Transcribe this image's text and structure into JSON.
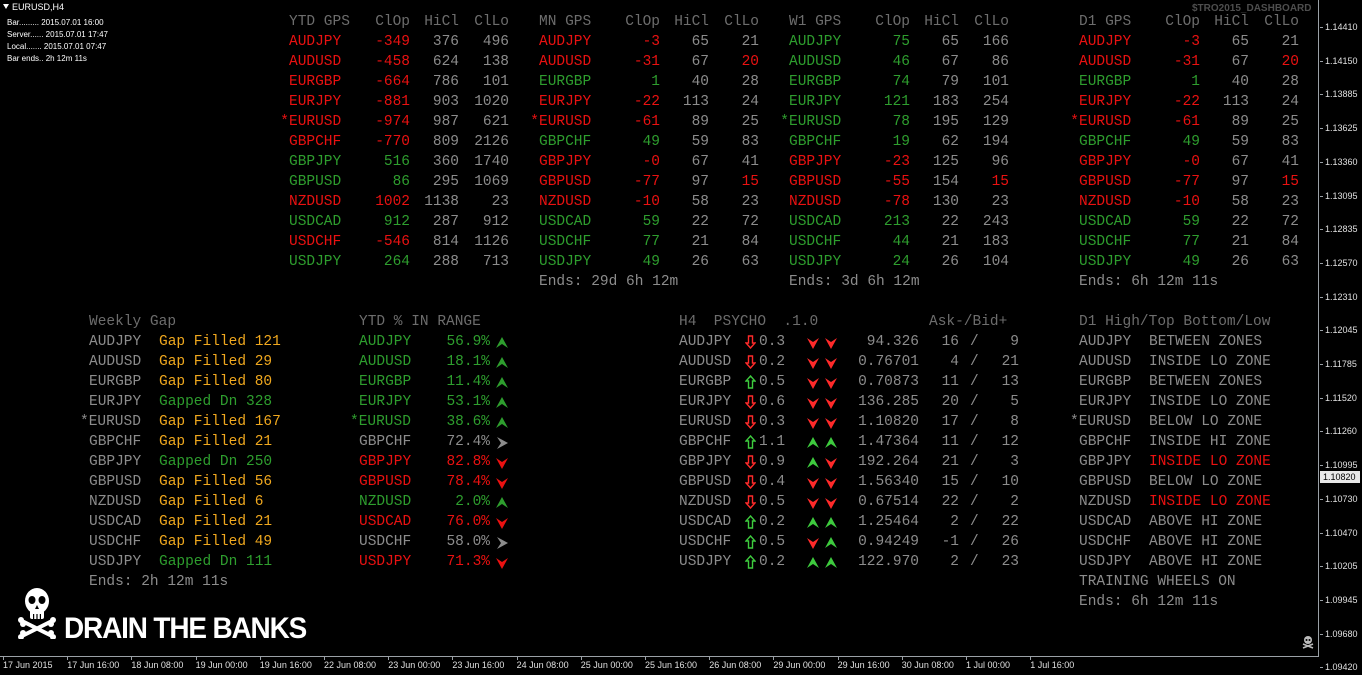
{
  "chart": {
    "symbol_tf": "EURUSD,H4",
    "info_lines": [
      "Bar......... 2015.07.01 16:00",
      "Server...... 2015.07.01 17:47",
      "Local....... 2015.07.01 07:47",
      "Bar ends.. 2h 12m 11s"
    ],
    "dashboard_name": "$TRO2015_DASHBOARD",
    "price_labels": [
      "1.14410",
      "1.14150",
      "1.13885",
      "1.13625",
      "1.13360",
      "1.13095",
      "1.12835",
      "1.12570",
      "1.12310",
      "1.12045",
      "1.11785",
      "1.11520",
      "1.11260",
      "1.10995",
      "1.10730",
      "1.10470",
      "1.10205",
      "1.09945",
      "1.09680",
      "1.09420"
    ],
    "current_price": "1.10820",
    "time_labels": [
      "17 Jun 2015",
      "17 Jun 16:00",
      "18 Jun 08:00",
      "19 Jun 00:00",
      "19 Jun 16:00",
      "22 Jun 08:00",
      "23 Jun 00:00",
      "23 Jun 16:00",
      "24 Jun 08:00",
      "25 Jun 00:00",
      "25 Jun 16:00",
      "26 Jun 08:00",
      "29 Jun 00:00",
      "29 Jun 16:00",
      "30 Jun 08:00",
      "1 Jul 00:00",
      "1 Jul 16:00"
    ],
    "logo_text": "DRAIN THE BANKS",
    "logo_icon": "skull-crossbones-icon"
  },
  "gps_columns": [
    "ClOp",
    "HiCl",
    "ClLo"
  ],
  "gps_tables": [
    {
      "title": "YTD GPS",
      "ends": "",
      "rows": [
        {
          "pair": "AUDJPY",
          "c": "r",
          "v": [
            "-349",
            "376",
            "496"
          ],
          "hl": [
            0,
            0,
            0
          ]
        },
        {
          "pair": "AUDUSD",
          "c": "r",
          "v": [
            "-458",
            "624",
            "138"
          ],
          "hl": [
            0,
            0,
            0
          ]
        },
        {
          "pair": "EURGBP",
          "c": "r",
          "v": [
            "-664",
            "786",
            "101"
          ],
          "hl": [
            0,
            0,
            0
          ]
        },
        {
          "pair": "EURJPY",
          "c": "r",
          "v": [
            "-881",
            "903",
            "1020"
          ],
          "hl": [
            0,
            0,
            0
          ]
        },
        {
          "pair": "*EURUSD",
          "c": "r",
          "v": [
            "-974",
            "987",
            "621"
          ],
          "hl": [
            0,
            0,
            0
          ]
        },
        {
          "pair": "GBPCHF",
          "c": "r",
          "v": [
            "-770",
            "809",
            "2126"
          ],
          "hl": [
            0,
            0,
            0
          ]
        },
        {
          "pair": "GBPJPY",
          "c": "g",
          "v": [
            "516",
            "360",
            "1740"
          ],
          "hl": [
            0,
            0,
            0
          ]
        },
        {
          "pair": "GBPUSD",
          "c": "g",
          "v": [
            "86",
            "295",
            "1069"
          ],
          "hl": [
            0,
            0,
            0
          ]
        },
        {
          "pair": "NZDUSD",
          "c": "r",
          "v": [
            "1002",
            "1138",
            "23"
          ],
          "hl": [
            0,
            0,
            0
          ]
        },
        {
          "pair": "USDCAD",
          "c": "g",
          "v": [
            "912",
            "287",
            "912"
          ],
          "hl": [
            0,
            0,
            0
          ]
        },
        {
          "pair": "USDCHF",
          "c": "r",
          "v": [
            "-546",
            "814",
            "1126"
          ],
          "hl": [
            0,
            0,
            0
          ]
        },
        {
          "pair": "USDJPY",
          "c": "g",
          "v": [
            "264",
            "288",
            "713"
          ],
          "hl": [
            0,
            0,
            0
          ]
        }
      ]
    },
    {
      "title": "MN GPS",
      "ends": "Ends: 29d 6h 12m",
      "rows": [
        {
          "pair": "AUDJPY",
          "c": "r",
          "v": [
            "-3",
            "65",
            "21"
          ],
          "hl": [
            0,
            0,
            0
          ]
        },
        {
          "pair": "AUDUSD",
          "c": "r",
          "v": [
            "-31",
            "67",
            "20"
          ],
          "hl": [
            0,
            0,
            1
          ]
        },
        {
          "pair": "EURGBP",
          "c": "g",
          "v": [
            "1",
            "40",
            "28"
          ],
          "hl": [
            0,
            0,
            0
          ]
        },
        {
          "pair": "EURJPY",
          "c": "r",
          "v": [
            "-22",
            "113",
            "24"
          ],
          "hl": [
            0,
            0,
            0
          ]
        },
        {
          "pair": "*EURUSD",
          "c": "r",
          "v": [
            "-61",
            "89",
            "25"
          ],
          "hl": [
            0,
            0,
            0
          ]
        },
        {
          "pair": "GBPCHF",
          "c": "g",
          "v": [
            "49",
            "59",
            "83"
          ],
          "hl": [
            0,
            0,
            0
          ]
        },
        {
          "pair": "GBPJPY",
          "c": "r",
          "v": [
            "-0",
            "67",
            "41"
          ],
          "hl": [
            0,
            0,
            0
          ]
        },
        {
          "pair": "GBPUSD",
          "c": "r",
          "v": [
            "-77",
            "97",
            "15"
          ],
          "hl": [
            0,
            0,
            1
          ]
        },
        {
          "pair": "NZDUSD",
          "c": "r",
          "v": [
            "-10",
            "58",
            "23"
          ],
          "hl": [
            0,
            0,
            0
          ]
        },
        {
          "pair": "USDCAD",
          "c": "g",
          "v": [
            "59",
            "22",
            "72"
          ],
          "hl": [
            0,
            0,
            0
          ]
        },
        {
          "pair": "USDCHF",
          "c": "g",
          "v": [
            "77",
            "21",
            "84"
          ],
          "hl": [
            0,
            0,
            0
          ]
        },
        {
          "pair": "USDJPY",
          "c": "g",
          "v": [
            "49",
            "26",
            "63"
          ],
          "hl": [
            0,
            0,
            0
          ]
        }
      ]
    },
    {
      "title": "W1 GPS",
      "ends": "Ends: 3d 6h 12m",
      "rows": [
        {
          "pair": "AUDJPY",
          "c": "g",
          "v": [
            "75",
            "65",
            "166"
          ],
          "hl": [
            0,
            0,
            0
          ]
        },
        {
          "pair": "AUDUSD",
          "c": "g",
          "v": [
            "46",
            "67",
            "86"
          ],
          "hl": [
            0,
            0,
            0
          ]
        },
        {
          "pair": "EURGBP",
          "c": "g",
          "v": [
            "74",
            "79",
            "101"
          ],
          "hl": [
            0,
            0,
            0
          ]
        },
        {
          "pair": "EURJPY",
          "c": "g",
          "v": [
            "121",
            "183",
            "254"
          ],
          "hl": [
            0,
            0,
            0
          ]
        },
        {
          "pair": "*EURUSD",
          "c": "g",
          "v": [
            "78",
            "195",
            "129"
          ],
          "hl": [
            0,
            0,
            0
          ]
        },
        {
          "pair": "GBPCHF",
          "c": "g",
          "v": [
            "19",
            "62",
            "194"
          ],
          "hl": [
            0,
            0,
            0
          ]
        },
        {
          "pair": "GBPJPY",
          "c": "r",
          "v": [
            "-23",
            "125",
            "96"
          ],
          "hl": [
            0,
            0,
            0
          ]
        },
        {
          "pair": "GBPUSD",
          "c": "r",
          "v": [
            "-55",
            "154",
            "15"
          ],
          "hl": [
            0,
            0,
            1
          ]
        },
        {
          "pair": "NZDUSD",
          "c": "r",
          "v": [
            "-78",
            "130",
            "23"
          ],
          "hl": [
            0,
            0,
            0
          ]
        },
        {
          "pair": "USDCAD",
          "c": "g",
          "v": [
            "213",
            "22",
            "243"
          ],
          "hl": [
            0,
            0,
            0
          ]
        },
        {
          "pair": "USDCHF",
          "c": "g",
          "v": [
            "44",
            "21",
            "183"
          ],
          "hl": [
            0,
            0,
            0
          ]
        },
        {
          "pair": "USDJPY",
          "c": "g",
          "v": [
            "24",
            "26",
            "104"
          ],
          "hl": [
            0,
            0,
            0
          ]
        }
      ]
    },
    {
      "title": "D1 GPS",
      "ends": "Ends: 6h 12m 11s",
      "rows": [
        {
          "pair": "AUDJPY",
          "c": "r",
          "v": [
            "-3",
            "65",
            "21"
          ],
          "hl": [
            0,
            0,
            0
          ]
        },
        {
          "pair": "AUDUSD",
          "c": "r",
          "v": [
            "-31",
            "67",
            "20"
          ],
          "hl": [
            0,
            0,
            1
          ]
        },
        {
          "pair": "EURGBP",
          "c": "g",
          "v": [
            "1",
            "40",
            "28"
          ],
          "hl": [
            0,
            0,
            0
          ]
        },
        {
          "pair": "EURJPY",
          "c": "r",
          "v": [
            "-22",
            "113",
            "24"
          ],
          "hl": [
            0,
            0,
            0
          ]
        },
        {
          "pair": "*EURUSD",
          "c": "r",
          "v": [
            "-61",
            "89",
            "25"
          ],
          "hl": [
            0,
            0,
            0
          ]
        },
        {
          "pair": "GBPCHF",
          "c": "g",
          "v": [
            "49",
            "59",
            "83"
          ],
          "hl": [
            0,
            0,
            0
          ]
        },
        {
          "pair": "GBPJPY",
          "c": "r",
          "v": [
            "-0",
            "67",
            "41"
          ],
          "hl": [
            0,
            0,
            0
          ]
        },
        {
          "pair": "GBPUSD",
          "c": "r",
          "v": [
            "-77",
            "97",
            "15"
          ],
          "hl": [
            0,
            0,
            1
          ]
        },
        {
          "pair": "NZDUSD",
          "c": "r",
          "v": [
            "-10",
            "58",
            "23"
          ],
          "hl": [
            0,
            0,
            0
          ]
        },
        {
          "pair": "USDCAD",
          "c": "g",
          "v": [
            "59",
            "22",
            "72"
          ],
          "hl": [
            0,
            0,
            0
          ]
        },
        {
          "pair": "USDCHF",
          "c": "g",
          "v": [
            "77",
            "21",
            "84"
          ],
          "hl": [
            0,
            0,
            0
          ]
        },
        {
          "pair": "USDJPY",
          "c": "g",
          "v": [
            "49",
            "26",
            "63"
          ],
          "hl": [
            0,
            0,
            0
          ]
        }
      ]
    }
  ],
  "weekly_gap": {
    "title": "Weekly Gap",
    "ends": "Ends: 2h 12m 11s",
    "rows": [
      {
        "pair": "AUDJPY",
        "status": "Gap Filled 121",
        "c": "o"
      },
      {
        "pair": "AUDUSD",
        "status": "Gap Filled 29",
        "c": "o"
      },
      {
        "pair": "EURGBP",
        "status": "Gap Filled 80",
        "c": "o"
      },
      {
        "pair": "EURJPY",
        "status": "Gapped Dn 328",
        "c": "g"
      },
      {
        "pair": "*EURUSD",
        "status": "Gap Filled 167",
        "c": "o"
      },
      {
        "pair": "GBPCHF",
        "status": "Gap Filled 21",
        "c": "o"
      },
      {
        "pair": "GBPJPY",
        "status": "Gapped Dn 250",
        "c": "g"
      },
      {
        "pair": "GBPUSD",
        "status": "Gap Filled 56",
        "c": "o"
      },
      {
        "pair": "NZDUSD",
        "status": "Gap Filled 6",
        "c": "o"
      },
      {
        "pair": "USDCAD",
        "status": "Gap Filled 21",
        "c": "o"
      },
      {
        "pair": "USDCHF",
        "status": "Gap Filled 49",
        "c": "o"
      },
      {
        "pair": "USDJPY",
        "status": "Gapped Dn 111",
        "c": "g"
      }
    ]
  },
  "ytd_range": {
    "title": "YTD % IN RANGE",
    "rows": [
      {
        "pair": "AUDJPY",
        "pct": "56.9%",
        "c": "g",
        "arrow": "up"
      },
      {
        "pair": "AUDUSD",
        "pct": "18.1%",
        "c": "g",
        "arrow": "up"
      },
      {
        "pair": "EURGBP",
        "pct": "11.4%",
        "c": "g",
        "arrow": "up"
      },
      {
        "pair": "EURJPY",
        "pct": "53.1%",
        "c": "g",
        "arrow": "up"
      },
      {
        "pair": "*EURUSD",
        "pct": "38.6%",
        "c": "g",
        "arrow": "up"
      },
      {
        "pair": "GBPCHF",
        "pct": "72.4%",
        "c": "gr",
        "arrow": "right"
      },
      {
        "pair": "GBPJPY",
        "pct": "82.8%",
        "c": "r",
        "arrow": "down"
      },
      {
        "pair": "GBPUSD",
        "pct": "78.4%",
        "c": "r",
        "arrow": "down"
      },
      {
        "pair": "NZDUSD",
        "pct": "2.0%",
        "c": "g",
        "arrow": "up"
      },
      {
        "pair": "USDCAD",
        "pct": "76.0%",
        "c": "r",
        "arrow": "down"
      },
      {
        "pair": "USDCHF",
        "pct": "58.0%",
        "c": "gr",
        "arrow": "right"
      },
      {
        "pair": "USDJPY",
        "pct": "71.3%",
        "c": "r",
        "arrow": "down"
      }
    ]
  },
  "psycho": {
    "title": "H4  PSYCHO  .1.0",
    "askbid": "Ask-/Bid+",
    "rows": [
      {
        "pair": "AUDJPY",
        "dir": "down",
        "val": "0.3",
        "a1": "down",
        "a2": "down",
        "price": "94.326",
        "ask": "16",
        "bid": "9"
      },
      {
        "pair": "AUDUSD",
        "dir": "down",
        "val": "0.2",
        "a1": "down",
        "a2": "down",
        "price": "0.76701",
        "ask": "4",
        "bid": "21"
      },
      {
        "pair": "EURGBP",
        "dir": "up",
        "val": "0.5",
        "a1": "down",
        "a2": "down",
        "price": "0.70873",
        "ask": "11",
        "bid": "13"
      },
      {
        "pair": "EURJPY",
        "dir": "down",
        "val": "0.6",
        "a1": "down",
        "a2": "down",
        "price": "136.285",
        "ask": "20",
        "bid": "5"
      },
      {
        "pair": "EURUSD",
        "dir": "down",
        "val": "0.3",
        "a1": "down",
        "a2": "down",
        "price": "1.10820",
        "ask": "17",
        "bid": "8"
      },
      {
        "pair": "GBPCHF",
        "dir": "up",
        "val": "1.1",
        "a1": "up",
        "a2": "up",
        "price": "1.47364",
        "ask": "11",
        "bid": "12"
      },
      {
        "pair": "GBPJPY",
        "dir": "down",
        "val": "0.9",
        "a1": "up",
        "a2": "down",
        "price": "192.264",
        "ask": "21",
        "bid": "3"
      },
      {
        "pair": "GBPUSD",
        "dir": "down",
        "val": "0.4",
        "a1": "down",
        "a2": "down",
        "price": "1.56340",
        "ask": "15",
        "bid": "10"
      },
      {
        "pair": "NZDUSD",
        "dir": "down",
        "val": "0.5",
        "a1": "down",
        "a2": "down",
        "price": "0.67514",
        "ask": "22",
        "bid": "2"
      },
      {
        "pair": "USDCAD",
        "dir": "up",
        "val": "0.2",
        "a1": "up",
        "a2": "up",
        "price": "1.25464",
        "ask": "2",
        "bid": "22"
      },
      {
        "pair": "USDCHF",
        "dir": "up",
        "val": "0.5",
        "a1": "down",
        "a2": "up",
        "price": "0.94249",
        "ask": "-1",
        "bid": "26"
      },
      {
        "pair": "USDJPY",
        "dir": "up",
        "val": "0.2",
        "a1": "up",
        "a2": "up",
        "price": "122.970",
        "ask": "2",
        "bid": "23"
      }
    ]
  },
  "zones": {
    "title": "D1 High/Top Bottom/Low",
    "footer": "TRAINING WHEELS ON",
    "ends": "Ends: 6h 12m 11s",
    "rows": [
      {
        "pair": "AUDJPY",
        "zone": "BETWEEN ZONES",
        "c": "gr"
      },
      {
        "pair": "AUDUSD",
        "zone": "INSIDE LO ZONE",
        "c": "gr"
      },
      {
        "pair": "EURGBP",
        "zone": "BETWEEN ZONES",
        "c": "gr"
      },
      {
        "pair": "EURJPY",
        "zone": "INSIDE LO ZONE",
        "c": "gr"
      },
      {
        "pair": "*EURUSD",
        "zone": "BELOW LO ZONE",
        "c": "gr"
      },
      {
        "pair": "GBPCHF",
        "zone": "INSIDE HI ZONE",
        "c": "gr"
      },
      {
        "pair": "GBPJPY",
        "zone": "INSIDE LO ZONE",
        "c": "r"
      },
      {
        "pair": "GBPUSD",
        "zone": "BELOW LO ZONE",
        "c": "gr"
      },
      {
        "pair": "NZDUSD",
        "zone": "INSIDE LO ZONE",
        "c": "r"
      },
      {
        "pair": "USDCAD",
        "zone": "ABOVE HI ZONE",
        "c": "gr"
      },
      {
        "pair": "USDCHF",
        "zone": "ABOVE HI ZONE",
        "c": "gr"
      },
      {
        "pair": "USDJPY",
        "zone": "ABOVE HI ZONE",
        "c": "gr"
      }
    ]
  },
  "colors": {
    "green": "#2e9e2e",
    "red": "#ea1111",
    "grey": "#8c8c8c",
    "orange": "#f0a81e",
    "header": "#6d6d6d",
    "background": "#000000"
  }
}
